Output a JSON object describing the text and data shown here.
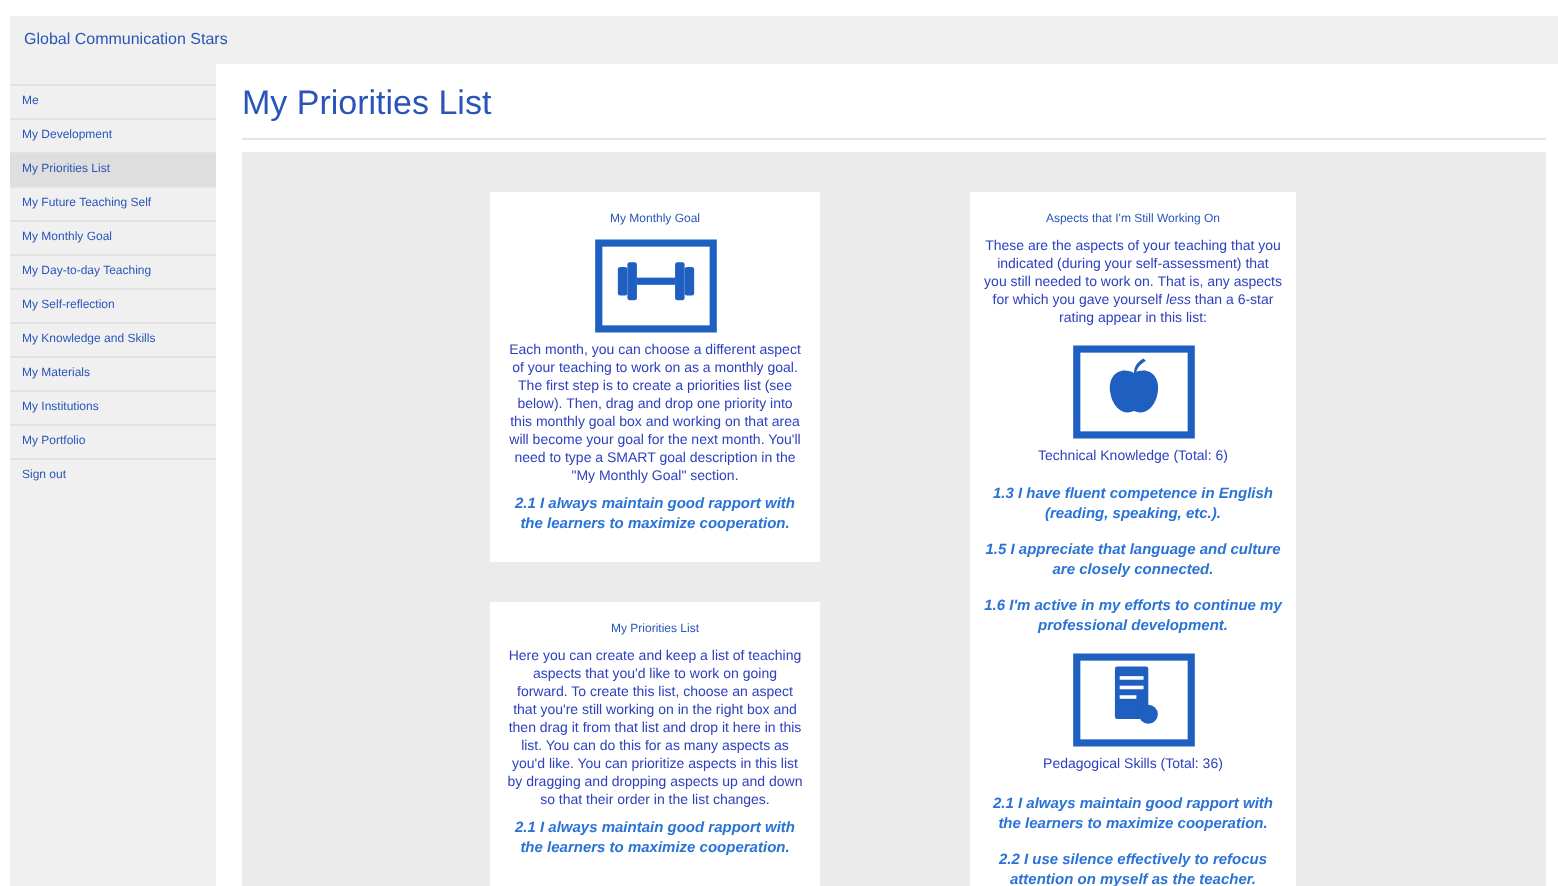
{
  "app_title": "Global Communication Stars",
  "sidebar": {
    "items": [
      {
        "label": "Me",
        "selected": false
      },
      {
        "label": "My Development",
        "selected": false
      },
      {
        "label": "My Priorities List",
        "selected": true
      },
      {
        "label": "My Future Teaching Self",
        "selected": false
      },
      {
        "label": "My Monthly Goal",
        "selected": false
      },
      {
        "label": "My Day-to-day Teaching",
        "selected": false
      },
      {
        "label": "My Self-reflection",
        "selected": false
      },
      {
        "label": "My Knowledge and Skills",
        "selected": false
      },
      {
        "label": "My Materials",
        "selected": false
      },
      {
        "label": "My Institutions",
        "selected": false
      },
      {
        "label": "My Portfolio",
        "selected": false
      },
      {
        "label": "Sign out",
        "selected": false
      }
    ]
  },
  "page_title": "My Priorities List",
  "left_cards": [
    {
      "title": "My Monthly Goal",
      "kind": "dumbbell",
      "description": "Each month, you can choose a different aspect of your teaching to work on as a monthly goal. The first step is to create a priorities list (see below). Then, drag and drop one priority into this monthly goal box and working on that area will become your goal for the next month. You'll need to type a SMART goal description in the \"My Monthly Goal\" section.",
      "aspects": [
        "2.1 I always maintain good rapport with the learners to maximize cooperation."
      ]
    },
    {
      "title": "My Priorities List",
      "description": "Here you can create and keep a list of teaching aspects that you'd like to work on going forward. To create this list, choose an aspect that you're still working on in the right box and then drag it from that list and drop it here in this list. You can do this for as many aspects as you'd like. You can prioritize aspects in this list by dragging and dropping aspects up and down so that their order in the list changes.",
      "aspects": [
        "2.1 I always maintain good rapport with the learners to maximize cooperation."
      ]
    }
  ],
  "right_card": {
    "title": "Aspects that I'm Still Working On",
    "description": "These are the aspects of your teaching that you indicated (during your self-assessment) that you still needed to work on. That is, any aspects for which you gave yourself *less* than a 6-star rating appear in this list:",
    "groups": [
      {
        "kind": "apple",
        "heading": "Technical Knowledge (Total: 6)",
        "aspects": [
          "1.3 I have fluent competence in English (reading, speaking, etc.).",
          "1.5 I appreciate that language and culture are closely connected.",
          "1.6 I'm active in my efforts to continue my professional development."
        ]
      },
      {
        "kind": "clipboard",
        "heading": "Pedagogical Skills (Total: 36)",
        "aspects": [
          "2.1 I always maintain good rapport with the learners to maximize cooperation.",
          "2.2 I use silence effectively to refocus attention on myself as the teacher."
        ]
      }
    ]
  }
}
